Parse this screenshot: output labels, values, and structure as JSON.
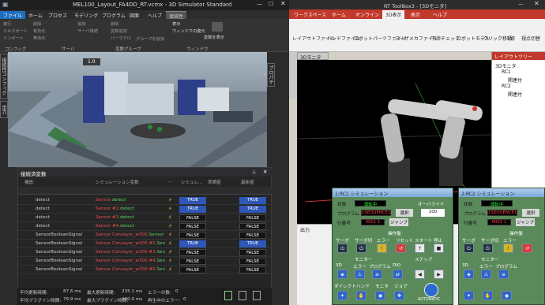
{
  "left": {
    "title": "MEL100_Layout_FA4DD_RT.vcmx - 3D Simulator Standard",
    "tabs": [
      "ファイル",
      "ホーム",
      "プロセス",
      "モデリング",
      "プログラム",
      "図面",
      "ヘルプ",
      "接続性"
    ],
    "ribbon": {
      "col1": [
        "実行",
        "エキスポート",
        "インポート"
      ],
      "col2": [
        "削除",
        "有効化",
        "無効化"
      ],
      "col3": [
        "追加",
        "サーバ接続"
      ],
      "col4": [
        "削除",
        "変数追加",
        "バーマクロ"
      ],
      "col5": [
        "グループを追加"
      ],
      "col6": [
        "表示",
        "ウィンドウの復元"
      ],
      "col7": [
        "変数を表示"
      ],
      "groups": [
        "コンフィグ",
        "サーバ",
        "変数グループ",
        "ウィンドウ"
      ]
    },
    "viewport_toolbar": "1.0",
    "side_tabs": [
      "接続性コンフィグ",
      "出力"
    ],
    "right_side_tab": "プロパティ",
    "vars_title": "接続済変数",
    "columns": [
      "構造",
      "シミュレーション変数",
      "...",
      "シミュレ...",
      "準備値",
      "最新値"
    ],
    "rows": [
      {
        "name": "detect",
        "sim": "Sensor",
        "sim_g": ".detect",
        "v1": "TRUE",
        "v2": "TRUE"
      },
      {
        "name": "detect",
        "sim": "Sensor #2",
        "sim_g": ".detect",
        "v1": "TRUE",
        "v2": "TRUE"
      },
      {
        "name": "detect",
        "sim": "Sensor #3",
        "sim_g": ".detect",
        "v1": "FALSE",
        "v2": "FALSE"
      },
      {
        "name": "detect",
        "sim": "Sensor #4",
        "sim_g": ".detect",
        "v1": "FALSE",
        "v2": "FALSE"
      },
      {
        "name": "SensorBooleanSignal",
        "sim": "Sensor Conveyor_w300",
        "sim_g": ".Sensor",
        "v1": "FALSE",
        "v2": "FALSE"
      },
      {
        "name": "SensorBooleanSignal",
        "sim": "Sensor Conveyor_w300 #2",
        "sim_g": ".Sensor",
        "v1": "TRUE",
        "v2": "TRUE"
      },
      {
        "name": "SensorBooleanSignal",
        "sim": "Sensor Conveyor_w300 #3",
        "sim_g": ".Sensor",
        "v1": "FALSE",
        "v2": "FALSE"
      },
      {
        "name": "SensorBooleanSignal",
        "sim": "Sensor Conveyor_w300 #4",
        "sim_g": ".Sensor",
        "v1": "FALSE",
        "v2": "FALSE"
      },
      {
        "name": "SensorBooleanSignal",
        "sim": "Sensor Conveyor_w300 #5",
        "sim_g": ".Sensor",
        "v1": "FALSE",
        "v2": "FALSE"
      }
    ],
    "status": {
      "avg_update_label": "平均更新時間:",
      "avg_update": "87.6 ms",
      "max_update_label": "最大更新時間:",
      "max_update": "235.1 ms",
      "errors_label": "エラーの数:",
      "errors": "0",
      "avg_plugin_label": "平均プラグイン時間:",
      "avg_plugin": "79.9 ms",
      "max_plugin_label": "最大プラグイン時間:",
      "max_plugin": "230.0 ms",
      "reconnect_label": "再生中のエラー:",
      "reconnect": "0"
    }
  },
  "right": {
    "title": "RT ToolBox3 - [3Dモニタ]",
    "tabs": [
      "ワークスペース",
      "ホーム",
      "オンライン",
      "3D表示",
      "表示",
      "ヘルプ"
    ],
    "ribbon": [
      "レイアウトファイル",
      "ハンドファイル",
      "ロボットパーツファイル",
      "ユーザメカファイル",
      "干渉チェック",
      "ロボットモデル",
      "クリック移動",
      "跡",
      "視点切替"
    ],
    "monitor_tab": "3Dモニタ",
    "layout_tree_title": "レイアウトツリー",
    "tree": [
      "3Dモニタ",
      "RC1",
      "関連付",
      "RC2",
      "関連付"
    ],
    "output_label": "出力",
    "sim1": {
      "title": "1:RC1 シミュレーション",
      "state_label": "状態",
      "state": "運転中",
      "override_label": "オーバライド",
      "override": "100",
      "program_label": "プログラム",
      "program": "1SEQUENCE1",
      "select": "選択",
      "line_label": "行番号",
      "line": "0001 1",
      "jump": "ジャンプ",
      "op": "操作盤",
      "buttons1": [
        "サーボ",
        "サーボ切",
        "エラー",
        "リセット",
        "スタート",
        "停止"
      ],
      "monitor": "モニター",
      "step": "ステップ",
      "buttons2": [
        "3D",
        "エラー",
        "プログラム",
        "DIO"
      ],
      "buttons3": [
        "ダイレクト",
        "ハンド",
        "モニタ",
        "ジョグ"
      ],
      "auto": "AUTOMATIC"
    },
    "sim2": {
      "title": "2:RC2 シミュレーション",
      "state_label": "状態",
      "state": "運転中",
      "program_label": "プログラム",
      "program": "1SEQUENCE1",
      "select": "選択",
      "line_label": "行番号",
      "line": "0001 1",
      "jump": "ジャンプ",
      "op": "操作盤",
      "buttons1": [
        "サーボ",
        "サーボ切",
        "エラー"
      ],
      "monitor": "モニター",
      "buttons2": [
        "3D",
        "エラー",
        "プログラム"
      ]
    }
  },
  "colors": {
    "true_badge": "#2e57b8",
    "false_badge": "#141414",
    "accent_red": "#c0392b",
    "sim_green": "#5a8a5a"
  }
}
